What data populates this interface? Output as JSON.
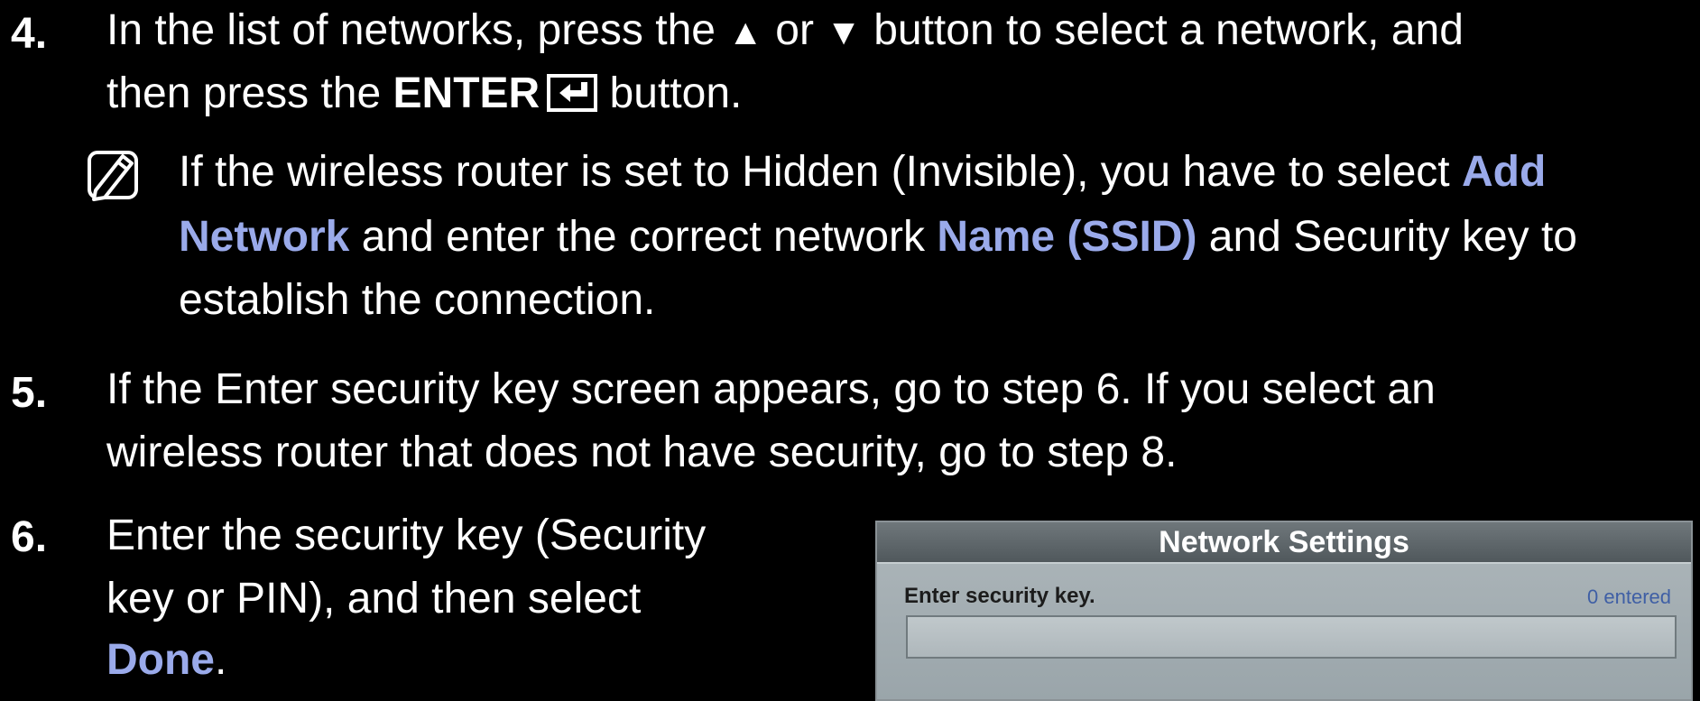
{
  "step4": {
    "number": "4.",
    "line1_a": "In the list of networks, press the ",
    "up_symbol": "▲",
    "or_text": " or ",
    "down_symbol": "▼",
    "line1_b": " button to select a network, and",
    "line2_a": "then press the ",
    "enter_label": "ENTER",
    "line2_b": " button."
  },
  "note": {
    "icon": "note-icon",
    "line1_a": "If the wireless router is set to Hidden (Invisible), you have to select ",
    "line1_hl": "Add",
    "line2_hl1": "Network",
    "line2_a": " and enter the correct network ",
    "line2_hl2": "Name (SSID)",
    "line2_b": " and Security key to",
    "line3": "establish the connection."
  },
  "step5": {
    "number": "5.",
    "line1": "If the Enter security key screen appears, go to step 6. If you select an",
    "line2": "wireless router that does not have security, go to step 8."
  },
  "step6": {
    "number": "6.",
    "line1": "Enter the security key (Security",
    "line2": "key or PIN), and then select",
    "line3_hl": "Done",
    "line3_end": "."
  },
  "panel": {
    "title": "Network Settings",
    "prompt": "Enter security key.",
    "count": "0 entered",
    "field_value": ""
  },
  "colors": {
    "background": "#000000",
    "highlight": "#9aaaea",
    "count_text": "#3f5fa5"
  }
}
